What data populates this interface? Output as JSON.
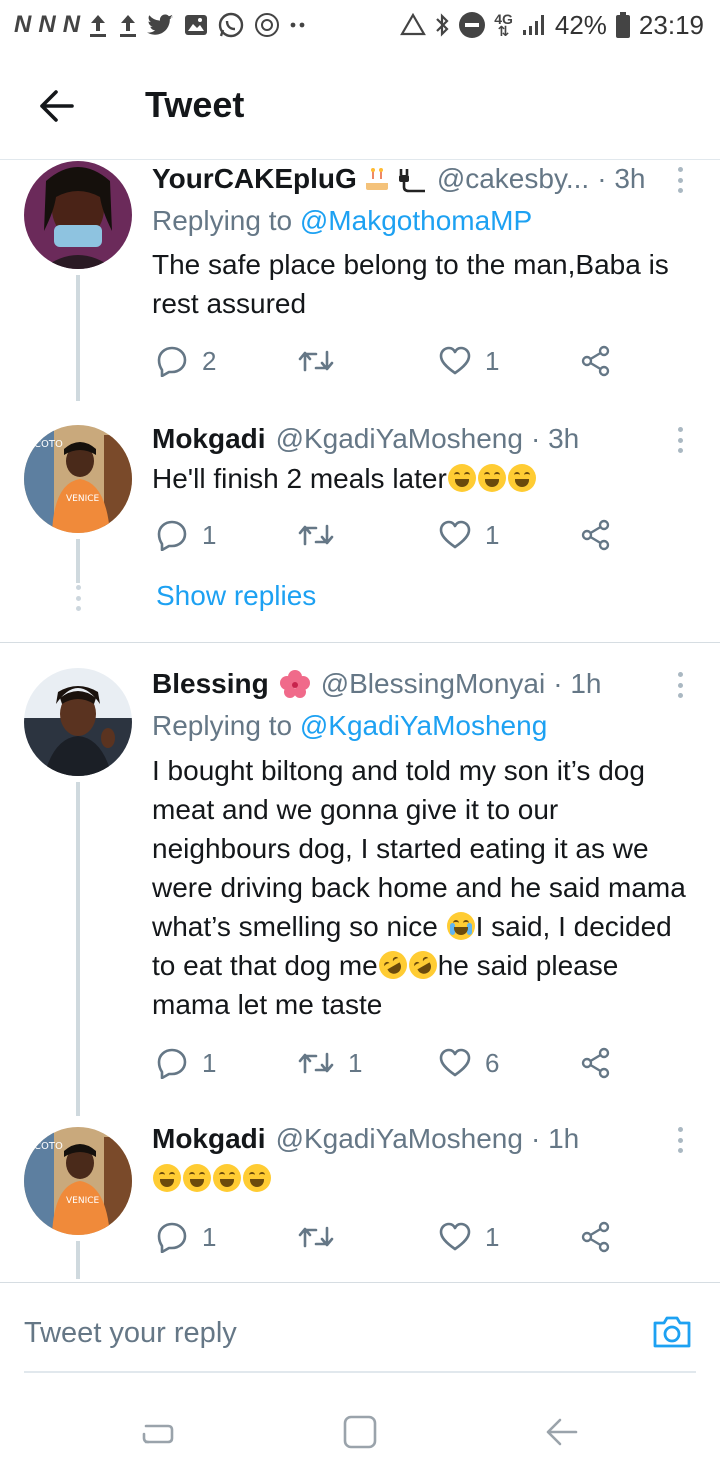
{
  "status_bar": {
    "carrier_marks": [
      "N",
      "N",
      "N"
    ],
    "network": "4G",
    "battery": "42%",
    "time": "23:19"
  },
  "header": {
    "title": "Tweet"
  },
  "tweets": [
    {
      "name": "YourCAKEpluG",
      "handle": "@cakesby...",
      "time": "· 3h",
      "replying_prefix": "Replying to",
      "replying_to": "@MakgothomaMP",
      "text": "The safe place belong to the man,Baba is rest assured",
      "replies": "2",
      "retweets": "",
      "likes": "1"
    },
    {
      "name": "Mokgadi",
      "handle": "@KgadiYaMosheng",
      "time": "· 3h",
      "text_before": "He'll finish 2 meals later",
      "emoji": [
        "face-with-tears-of-joy",
        "face-with-tears-of-joy",
        "face-with-tears-of-joy"
      ],
      "replies": "1",
      "retweets": "",
      "likes": "1",
      "show_replies": "Show replies"
    },
    {
      "name": "Blessing",
      "name_emoji": "hibiscus",
      "handle": "@BlessingMonyai",
      "time": "· 1h",
      "replying_prefix": "Replying to",
      "replying_to": "@KgadiYaMosheng",
      "text_part1": "I bought biltong and told my son it’s dog meat and we gonna give it to our neighbours dog, I started eating it as we were driving back home and he said mama what’s smelling so nice",
      "text_part2": "I said, I decided to eat that dog me",
      "text_part3": "he said please mama let me taste",
      "replies": "1",
      "retweets": "1",
      "likes": "6"
    },
    {
      "name": "Mokgadi",
      "handle": "@KgadiYaMosheng",
      "time": "· 1h",
      "emoji": [
        "face-with-tears-of-joy",
        "face-with-tears-of-joy",
        "face-with-tears-of-joy",
        "face-with-tears-of-joy"
      ],
      "replies": "1",
      "retweets": "",
      "likes": "1"
    }
  ],
  "reply_box": {
    "placeholder": "Tweet your reply"
  },
  "colors": {
    "accent": "#1da1f2",
    "secondary_text": "#657786",
    "primary_text": "#14171a",
    "thread_line": "#cfd9de"
  },
  "icons": [
    "back-arrow-icon",
    "more-icon",
    "reply-icon",
    "retweet-icon",
    "like-icon",
    "share-icon",
    "camera-icon",
    "recents-icon",
    "home-icon",
    "back-icon"
  ]
}
